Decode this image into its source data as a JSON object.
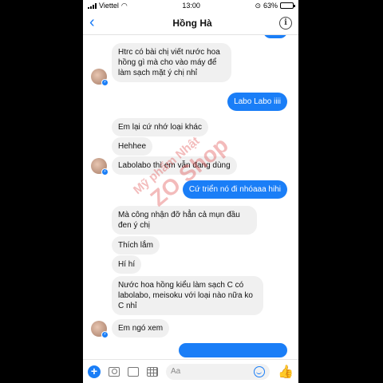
{
  "status": {
    "carrier": "Viettel",
    "time": "13:00",
    "battery": "63%",
    "battery_fraction": 0.63
  },
  "nav": {
    "back": "‹",
    "title": "Hồng Hà",
    "info": "i"
  },
  "messages": [
    {
      "side": "in",
      "text": "Htrc có bài chị viết nước hoa hồng gì mà cho vào máy để làm sạch mặt ý chị nhỉ"
    },
    {
      "side": "out",
      "text": "Labo Labo iiii"
    },
    {
      "side": "in",
      "text": "Em lại cứ nhớ loại khác"
    },
    {
      "side": "in",
      "text": "Hehhee"
    },
    {
      "side": "in",
      "text": "Labolabo thì em vẫn đang dùng"
    },
    {
      "side": "out",
      "text": "Cứ triển nó đi nhóaaa hihi"
    },
    {
      "side": "in",
      "text": "Mà công nhận đỡ hẳn cả mụn đầu đen ý chị"
    },
    {
      "side": "in",
      "text": "Thích lắm"
    },
    {
      "side": "in",
      "text": "Hí hí"
    },
    {
      "side": "in",
      "text": "Nước hoa hồng kiểu làm sạch C có labolabo, meisoku với loại nào nữa ko C nhỉ"
    },
    {
      "side": "in",
      "text": "Em ngó xem"
    }
  ],
  "watermark": {
    "line1": "Mỹ phẩm Nhật",
    "line2": "ZO Shop"
  },
  "composer": {
    "placeholder": "Aa"
  },
  "colors": {
    "accent": "#1a7ef7",
    "bubble_in": "#f0f0f0"
  }
}
